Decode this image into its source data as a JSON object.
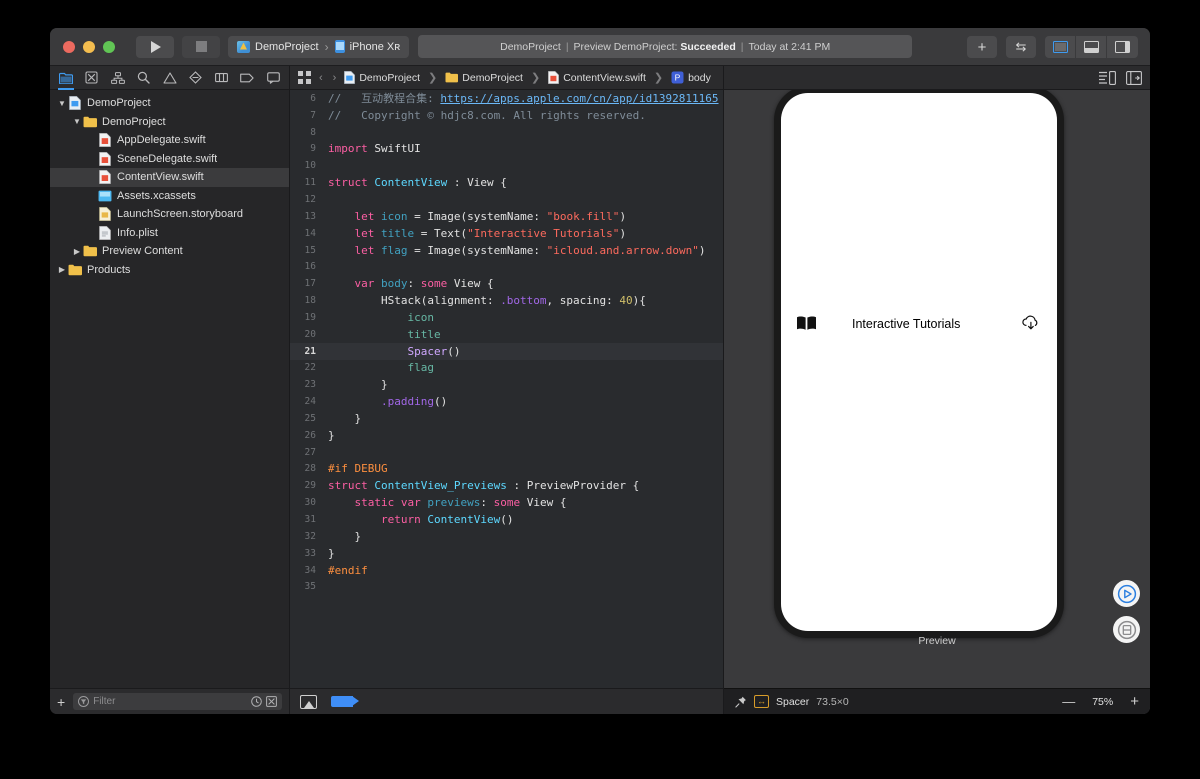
{
  "window": {
    "traffic_lights": [
      "close",
      "minimize",
      "zoom"
    ],
    "run_button": "run",
    "stop_button": "stop",
    "scheme": {
      "project": "DemoProject",
      "separator": "›",
      "device": "iPhone Xʀ"
    },
    "status": {
      "project": "DemoProject",
      "sep": "|",
      "action": "Preview DemoProject:",
      "result": "Succeeded",
      "time": "Today at 2:41 PM"
    },
    "toolbar_right": {
      "add_label": "+",
      "swap_label": "⇆",
      "panel_navigator": "show-navigator",
      "panel_debug": "show-debug-area",
      "panel_inspector": "show-inspector"
    }
  },
  "navigator": {
    "tabs": [
      {
        "name": "project-navigator",
        "icon": "folder-icon",
        "active": true
      },
      {
        "name": "source-control-navigator",
        "icon": "source-control-icon",
        "active": false
      },
      {
        "name": "symbol-navigator",
        "icon": "hierarchy-icon",
        "active": false
      },
      {
        "name": "find-navigator",
        "icon": "search-icon",
        "active": false
      },
      {
        "name": "issue-navigator",
        "icon": "warning-triangle-icon",
        "active": false
      },
      {
        "name": "test-navigator",
        "icon": "diamond-icon",
        "active": false
      },
      {
        "name": "debug-navigator",
        "icon": "debug-icon",
        "active": false
      },
      {
        "name": "breakpoint-navigator",
        "icon": "tag-icon",
        "active": false
      },
      {
        "name": "report-navigator",
        "icon": "speech-bubble-icon",
        "active": false
      }
    ],
    "tree": [
      {
        "label": "DemoProject",
        "indent": 0,
        "icon": "project-icon",
        "twisty": "open",
        "selected": false
      },
      {
        "label": "DemoProject",
        "indent": 1,
        "icon": "folder-icon",
        "twisty": "open",
        "selected": false
      },
      {
        "label": "AppDelegate.swift",
        "indent": 2,
        "icon": "swift-icon",
        "twisty": "none",
        "selected": false
      },
      {
        "label": "SceneDelegate.swift",
        "indent": 2,
        "icon": "swift-icon",
        "twisty": "none",
        "selected": false
      },
      {
        "label": "ContentView.swift",
        "indent": 2,
        "icon": "swift-icon",
        "twisty": "none",
        "selected": true
      },
      {
        "label": "Assets.xcassets",
        "indent": 2,
        "icon": "assets-icon",
        "twisty": "none",
        "selected": false
      },
      {
        "label": "LaunchScreen.storyboard",
        "indent": 2,
        "icon": "storyboard-icon",
        "twisty": "none",
        "selected": false
      },
      {
        "label": "Info.plist",
        "indent": 2,
        "icon": "plist-icon",
        "twisty": "none",
        "selected": false
      },
      {
        "label": "Preview Content",
        "indent": 1,
        "icon": "folder-icon",
        "twisty": "closed",
        "selected": false
      },
      {
        "label": "Products",
        "indent": 0,
        "icon": "folder-icon",
        "twisty": "closed",
        "selected": false
      }
    ],
    "filter": {
      "add_label": "+",
      "placeholder": "Filter",
      "recent_icon": "clock-icon",
      "scm_icon": "source-control-icon"
    }
  },
  "editor": {
    "breadcrumb": [
      {
        "label": "DemoProject",
        "icon": "project-icon"
      },
      {
        "label": "DemoProject",
        "icon": "folder-icon"
      },
      {
        "label": "ContentView.swift",
        "icon": "swift-icon"
      },
      {
        "label": "body",
        "icon": "property-icon"
      }
    ],
    "current_line": 21,
    "first_line": 6,
    "lines": [
      {
        "n": 6,
        "html": "<span class=\"c\">//   互动教程合集: </span><span class=\"u\">https://apps.apple.com/cn/app/id1392811165</span>"
      },
      {
        "n": 7,
        "html": "<span class=\"c\">//   Copyright © hdjc8.com. All rights reserved.</span>"
      },
      {
        "n": 8,
        "html": ""
      },
      {
        "n": 9,
        "html": "<span class=\"k\">import</span> SwiftUI"
      },
      {
        "n": 10,
        "html": ""
      },
      {
        "n": 11,
        "html": "<span class=\"k\">struct</span> <span class=\"t\">ContentView</span> : View {"
      },
      {
        "n": 12,
        "html": ""
      },
      {
        "n": 13,
        "html": "    <span class=\"k\">let</span> <span class=\"id\">icon</span> = Image(systemName: <span class=\"s\">\"book.fill\"</span>)"
      },
      {
        "n": 14,
        "html": "    <span class=\"k\">let</span> <span class=\"id\">title</span> = Text(<span class=\"s\">\"Interactive Tutorials\"</span>)"
      },
      {
        "n": 15,
        "html": "    <span class=\"k\">let</span> <span class=\"id\">flag</span> = Image(systemName: <span class=\"s\">\"icloud.and.arrow.down\"</span>)"
      },
      {
        "n": 16,
        "html": ""
      },
      {
        "n": 17,
        "html": "    <span class=\"k\">var</span> <span class=\"id\">body</span>: <span class=\"k\">some</span> View {"
      },
      {
        "n": 18,
        "html": "        HStack(alignment: <span class=\"m\">.bottom</span>, spacing: <span class=\"n\">40</span>){"
      },
      {
        "n": 19,
        "html": "            <span class=\"g\">icon</span>"
      },
      {
        "n": 20,
        "html": "            <span class=\"g\">title</span>"
      },
      {
        "n": 21,
        "html": "            <span class=\"ty\">Spacer</span>()"
      },
      {
        "n": 22,
        "html": "            <span class=\"g\">flag</span>"
      },
      {
        "n": 23,
        "html": "        }"
      },
      {
        "n": 24,
        "html": "        <span class=\"m\">.padding</span>()"
      },
      {
        "n": 25,
        "html": "    }"
      },
      {
        "n": 26,
        "html": "}"
      },
      {
        "n": 27,
        "html": ""
      },
      {
        "n": 28,
        "html": "<span class=\"p\">#if DEBUG</span>"
      },
      {
        "n": 29,
        "html": "<span class=\"k\">struct</span> <span class=\"t\">ContentView_Previews</span> : PreviewProvider {"
      },
      {
        "n": 30,
        "html": "    <span class=\"k\">static</span> <span class=\"k\">var</span> <span class=\"id\">previews</span>: <span class=\"k\">some</span> View {"
      },
      {
        "n": 31,
        "html": "        <span class=\"k\">return</span> <span class=\"t\">ContentView</span>()"
      },
      {
        "n": 32,
        "html": "    }"
      },
      {
        "n": 33,
        "html": "}"
      },
      {
        "n": 34,
        "html": "<span class=\"p\">#endif</span>"
      },
      {
        "n": 35,
        "html": ""
      }
    ],
    "bottom_bar": {
      "canvas_toggle": "canvas-icon",
      "tag": "blue-tag"
    }
  },
  "canvas": {
    "toolbar": {
      "inspector_toggle": "inspector-icon",
      "library_toggle": "library-panel-icon"
    },
    "preview": {
      "icon": "book-fill-icon",
      "title": "Interactive Tutorials",
      "flag_icon": "icloud-and-arrow-down-icon",
      "label": "Preview"
    },
    "live_buttons": [
      {
        "name": "live-preview-button",
        "icon": "play-circle-icon"
      },
      {
        "name": "inspect-preview-button",
        "icon": "inspect-circle-icon"
      }
    ],
    "status": {
      "pin_icon": "pin-icon",
      "element_badge": "spacer-badge",
      "element_name": "Spacer",
      "element_size": "73.5×0",
      "zoom_out": "—",
      "zoom_level": "75%",
      "zoom_in": "+"
    }
  },
  "colors": {
    "accent": "#3f9bf0",
    "window_chrome": "#3a3a3c",
    "navigator_bg": "#262628",
    "editor_bg": "#292b2e",
    "canvas_bg": "#3a3a3c",
    "keyword": "#fc5fa3",
    "string": "#fc6a5d",
    "comment": "#7f8c98",
    "type": "#5dd8ff",
    "badge_orange": "#d79c2a"
  }
}
